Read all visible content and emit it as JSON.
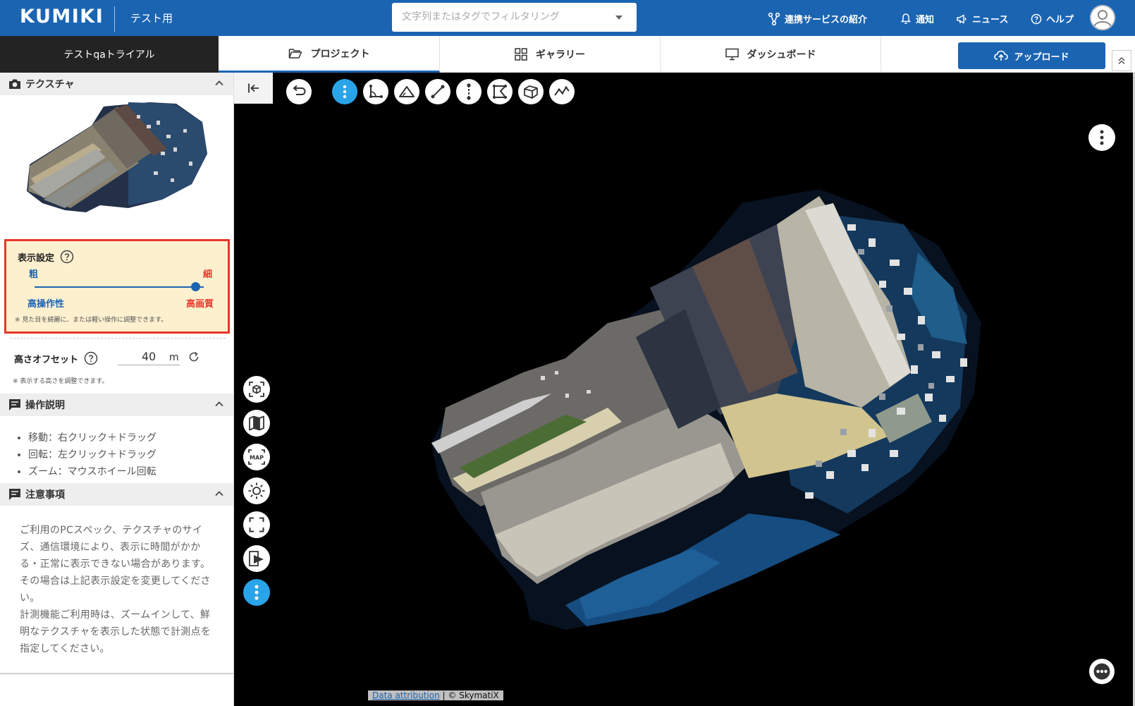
{
  "header": {
    "logo": "KUMIKI",
    "workspace": "テスト用",
    "search_placeholder": "文字列またはタグでフィルタリング",
    "nav": [
      {
        "label": "連携サービスの紹介",
        "icon": "share-nodes-icon"
      },
      {
        "label": "通知",
        "icon": "bell-icon"
      },
      {
        "label": "ニュース",
        "icon": "megaphone-icon"
      },
      {
        "label": "ヘルプ",
        "icon": "question-circle-icon"
      }
    ]
  },
  "tabs": {
    "trial_label": "テストqaトライアル",
    "items": [
      {
        "label": "プロジェクト",
        "icon": "folder-icon",
        "active": true
      },
      {
        "label": "ギャラリー",
        "icon": "grid-icon",
        "active": false
      },
      {
        "label": "ダッシュボード",
        "icon": "monitor-icon",
        "active": false
      }
    ],
    "upload_label": "アップロード"
  },
  "left_panel": {
    "texture": {
      "title": "テクスチャ"
    },
    "display_settings": {
      "title": "表示設定",
      "coarse": "粗",
      "fine": "細",
      "left_caption": "高操作性",
      "right_caption": "高画質",
      "slider_value": 0.95,
      "note": "※ 見た目を綺麗に、または軽い操作に調整できます。"
    },
    "height_offset": {
      "label": "高さオフセット",
      "value": "40",
      "unit": "m",
      "note": "※ 表示する高さを調整できます。"
    },
    "operations": {
      "title": "操作説明",
      "items": [
        "移動：右クリック＋ドラッグ",
        "回転：左クリック＋ドラッグ",
        "ズーム：マウスホイール回転"
      ]
    },
    "caution": {
      "title": "注意事項",
      "text_1": "ご利用のPCスペック、テクスチャのサイズ、通信環境により、表示に時間がかかる・正常に表示できない場合があります。その場合は上記表示設定を変更してください。",
      "text_2": "計測機能ご利用時は、ズームインして、鮮明なテクスチャを表示した状態で計測点を指定してください。"
    }
  },
  "viewer": {
    "top_tools": [
      "undo-icon",
      "more-vertical-icon",
      "angle-measure-icon",
      "triangle-measure-icon",
      "distance-measure-icon",
      "vertical-measure-icon",
      "area-measure-icon",
      "volume-measure-icon",
      "profile-measure-icon"
    ],
    "side_tools": [
      "fit-view-icon",
      "map-icon",
      "map-label-icon",
      "brightness-icon",
      "fullscreen-icon",
      "screenshot-icon",
      "more-vertical-icon"
    ],
    "attribution_link": "Data attribution",
    "attribution_text": "| © SkymatiX"
  },
  "colors": {
    "brand_blue": "#1b64b2",
    "active_tool": "#2aa4e8",
    "highlight_red": "#e8372a",
    "settings_bg": "#fdf0cf"
  }
}
